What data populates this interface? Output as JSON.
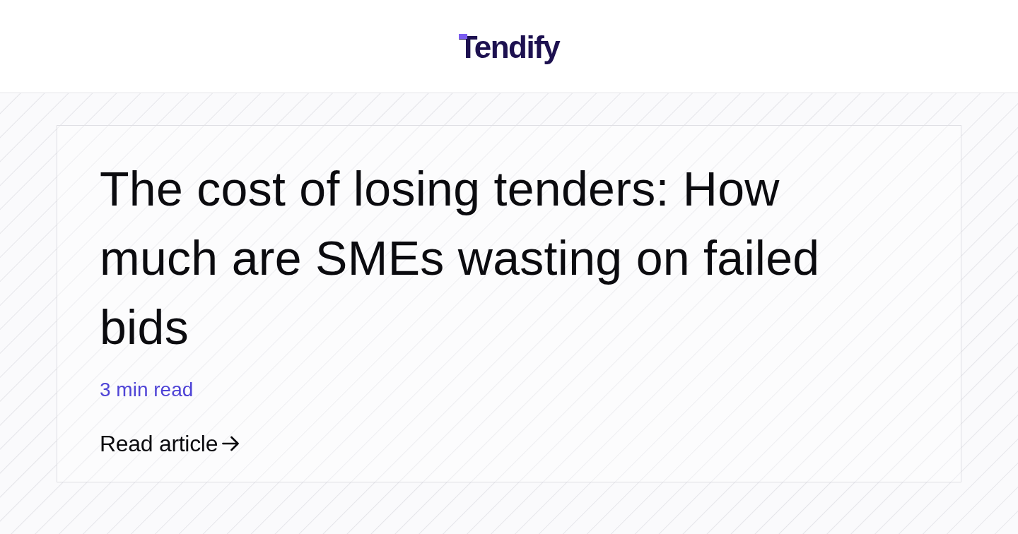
{
  "header": {
    "logo": "Tendify"
  },
  "article": {
    "title": "The cost of losing tenders: How much are SMEs wasting on failed bids",
    "read_time": "3 min read",
    "link": "Read article"
  }
}
